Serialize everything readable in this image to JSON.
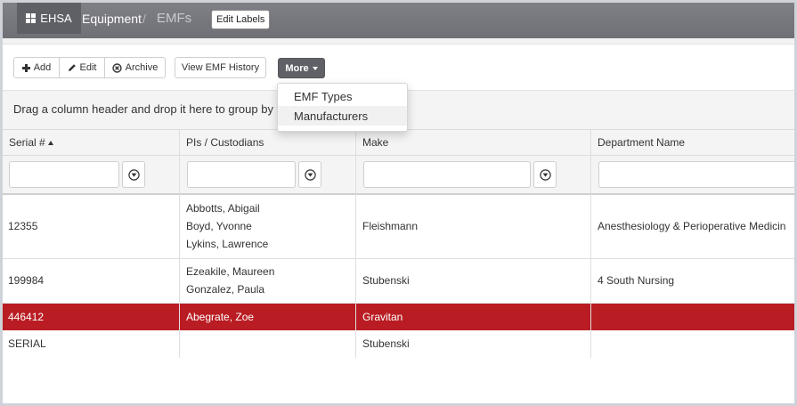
{
  "header": {
    "brand": "EHSA",
    "breadcrumb_equipment": "Equipment",
    "breadcrumb_sep": "/",
    "breadcrumb_current": "EMFs",
    "edit_labels": "Edit Labels"
  },
  "toolbar": {
    "add": "Add",
    "edit": "Edit",
    "archive": "Archive",
    "view_history": "View EMF History",
    "more": "More"
  },
  "more_menu": {
    "items": [
      "EMF Types",
      "Manufacturers"
    ]
  },
  "group_panel": {
    "text": "Drag a column header and drop it here to group by th"
  },
  "grid": {
    "columns": [
      "Serial #",
      "PIs / Custodians",
      "Make",
      "Department Name"
    ],
    "sort_column": "Serial #",
    "sort_direction": "ascending",
    "rows": [
      {
        "serial": "12355",
        "custodians": [
          "Abbotts, Abigail",
          "Boyd, Yvonne",
          "Lykins, Lawrence"
        ],
        "make": "Fleishmann",
        "department": "Anesthesiology & Perioperative Medicin"
      },
      {
        "serial": "199984",
        "custodians": [
          "Ezeakile, Maureen",
          "Gonzalez, Paula"
        ],
        "make": "Stubenski",
        "department": "4 South Nursing"
      },
      {
        "serial": "446412",
        "custodians": [
          "Abegrate, Zoe"
        ],
        "make": "Gravitan",
        "department": ""
      },
      {
        "serial": "SERIAL",
        "custodians": [],
        "make": "Stubenski",
        "department": ""
      }
    ],
    "selected_row_serial": "446412"
  },
  "colors": {
    "topbar": "#77787e",
    "brand_bg": "#5f6066",
    "more_button": "#5f6167",
    "selected_row": "#b91c22"
  },
  "icons": [
    "grid-icon",
    "plus-icon",
    "pencil-icon",
    "archive-icon",
    "caret-down-icon",
    "filter-icon",
    "sort-ascending-icon"
  ]
}
